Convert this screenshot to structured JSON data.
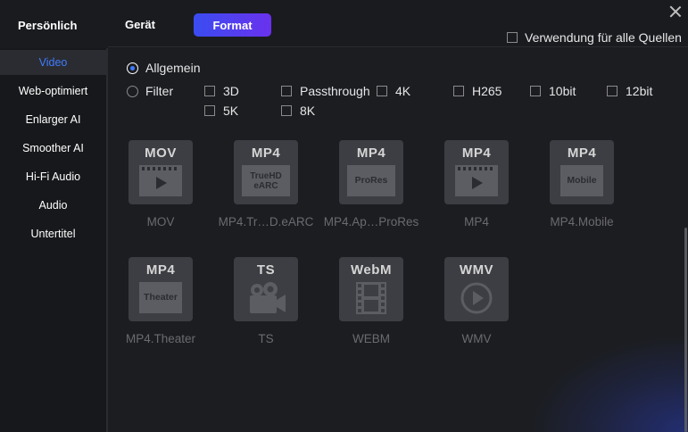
{
  "header": {
    "section_title": "Persönlich",
    "tabs": [
      {
        "label": "Gerät",
        "active": false
      },
      {
        "label": "Format",
        "active": true
      }
    ],
    "apply_all_label": "Verwendung für alle Quellen",
    "apply_all_checked": false
  },
  "sidebar": {
    "items": [
      {
        "label": "Video",
        "active": true
      },
      {
        "label": "Web-optimiert",
        "active": false
      },
      {
        "label": "Enlarger AI",
        "active": false
      },
      {
        "label": "Smoother AI",
        "active": false
      },
      {
        "label": "Hi-Fi Audio",
        "active": false
      },
      {
        "label": "Audio",
        "active": false
      },
      {
        "label": "Untertitel",
        "active": false
      }
    ]
  },
  "options": {
    "general_label": "Allgemein",
    "general_selected": true,
    "filter_label": "Filter",
    "filter_selected": false,
    "filters": [
      {
        "label": "3D",
        "checked": false
      },
      {
        "label": "Passthrough",
        "checked": false
      },
      {
        "label": "4K",
        "checked": false
      },
      {
        "label": "H265",
        "checked": false
      },
      {
        "label": "10bit",
        "checked": false
      },
      {
        "label": "12bit",
        "checked": false
      },
      {
        "label": "5K",
        "checked": false
      },
      {
        "label": "8K",
        "checked": false
      }
    ]
  },
  "formats": [
    {
      "header": "MOV",
      "inner": "",
      "icon": "play-film-icon",
      "label": "MOV"
    },
    {
      "header": "MP4",
      "inner": "TrueHD eARC",
      "icon": "truehd-earc-icon",
      "label": "MP4.Tr…D.eARC"
    },
    {
      "header": "MP4",
      "inner": "ProRes",
      "icon": "prores-icon",
      "label": "MP4.Ap…ProRes"
    },
    {
      "header": "MP4",
      "inner": "",
      "icon": "play-film-icon",
      "label": "MP4"
    },
    {
      "header": "MP4",
      "inner": "Mobile",
      "icon": "mobile-icon",
      "label": "MP4.Mobile"
    },
    {
      "header": "MP4",
      "inner": "Theater",
      "icon": "theater-icon",
      "label": "MP4.Theater"
    },
    {
      "header": "TS",
      "inner": "",
      "icon": "camcorder-icon",
      "label": "TS"
    },
    {
      "header": "WebM",
      "inner": "",
      "icon": "filmstrip-icon",
      "label": "WEBM"
    },
    {
      "header": "WMV",
      "inner": "",
      "icon": "play-circle-icon",
      "label": "WMV"
    }
  ],
  "colors": {
    "accent": "#3f7bff",
    "tab_gradient_start": "#3a4cf0",
    "tab_gradient_end": "#6a32ee",
    "background": "#1c1d21"
  }
}
